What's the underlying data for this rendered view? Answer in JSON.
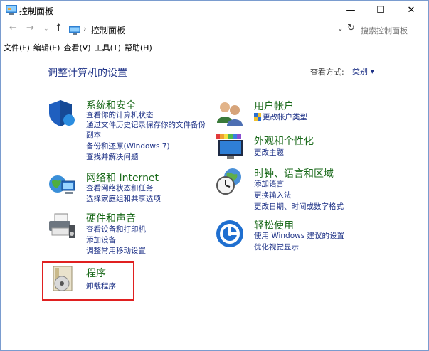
{
  "window": {
    "title": "控制面板",
    "minimize": "—",
    "maximize": "☐",
    "close": "✕"
  },
  "nav": {
    "back": "←",
    "forward": "→",
    "dropdown": "⌄",
    "up": "↑",
    "sep": "›",
    "path": "控制面板",
    "chevron": "⌄",
    "refresh": "↻",
    "search_placeholder": "搜索控制面板"
  },
  "menu": [
    "文件(F)",
    "编辑(E)",
    "查看(V)",
    "工具(T)",
    "帮助(H)"
  ],
  "main": {
    "heading": "调整计算机的设置",
    "view_by_label": "查看方式:",
    "view_by_value": "类别 ▾"
  },
  "categories": {
    "system": {
      "title": "系统和安全",
      "links": [
        "查看你的计算机状态",
        "通过文件历史记录保存你的文件备份",
        "副本",
        "备份和还原(Windows 7)",
        "查找并解决问题"
      ]
    },
    "network": {
      "title": "网络和 Internet",
      "links": [
        "查看网络状态和任务",
        "选择家庭组和共享选项"
      ]
    },
    "hardware": {
      "title": "硬件和声音",
      "links": [
        "查看设备和打印机",
        "添加设备",
        "调整常用移动设置"
      ]
    },
    "programs": {
      "title": "程序",
      "links": [
        "卸载程序"
      ]
    },
    "users": {
      "title": "用户帐户",
      "links": [
        "更改帐户类型"
      ]
    },
    "appearance": {
      "title": "外观和个性化",
      "links": [
        "更改主题"
      ]
    },
    "clock": {
      "title": "时钟、语言和区域",
      "links": [
        "添加语言",
        "更换输入法",
        "更改日期、时间或数字格式"
      ]
    },
    "ease": {
      "title": "轻松使用",
      "links": [
        "使用 Windows 建议的设置",
        "优化视觉显示"
      ]
    }
  },
  "colors": {
    "title_green": "#1c6b1c",
    "link_blue": "#1e3287",
    "highlight": "#e02020"
  }
}
